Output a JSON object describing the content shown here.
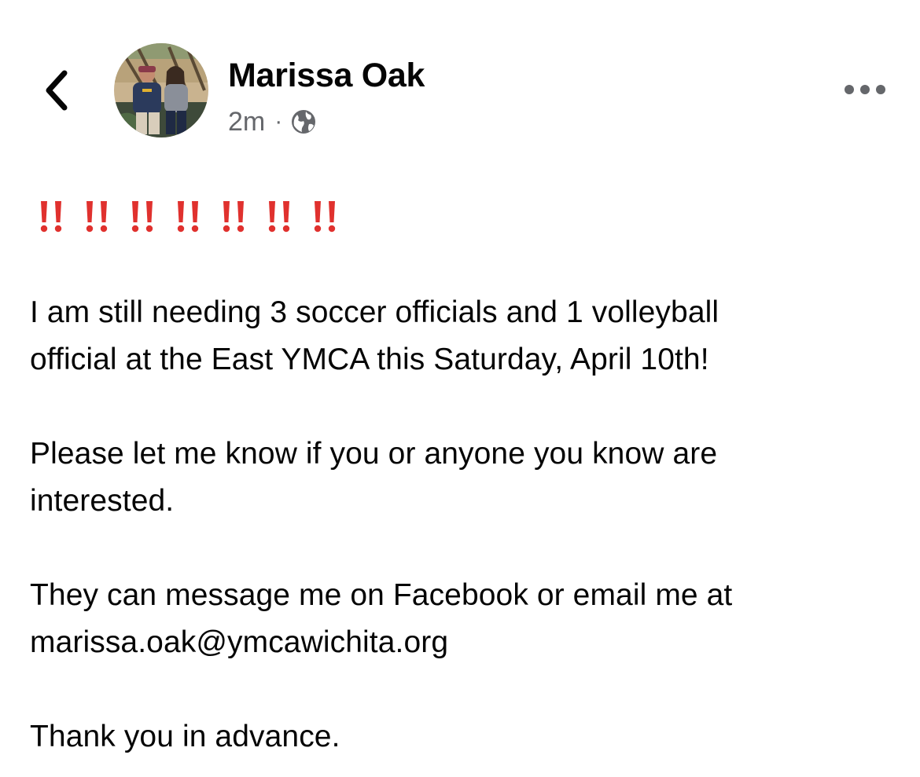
{
  "header": {
    "back_icon": "chevron-left-icon",
    "avatar_alt": "profile photo",
    "author_name": "Marissa Oak",
    "timestamp": "2m",
    "separator": "·",
    "audience_icon": "globe-icon",
    "more_icon": "more-horizontal-icon"
  },
  "post": {
    "emoji_icon": "double-exclamation-mark-icon",
    "emoji_count": 7,
    "emoji_color": "#e0312e",
    "paragraphs": [
      "I am still needing 3 soccer officials and 1 volleyball\nofficial at the East YMCA this Saturday, April 10th!",
      "Please let me know if you or anyone you know are\ninterested.",
      "They can message me on Facebook or email me at\nmarissa.oak@ymcawichita.org",
      "Thank you in advance."
    ]
  },
  "colors": {
    "text": "#050505",
    "secondary_text": "#65676b",
    "background": "#ffffff"
  }
}
